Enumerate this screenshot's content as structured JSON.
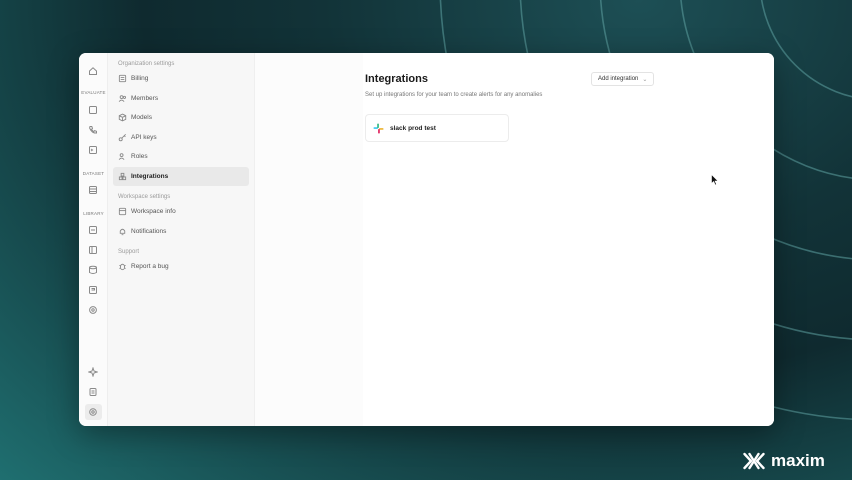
{
  "rail": {
    "evaluate_label": "EVALUATE",
    "dataset_label": "DATASET",
    "library_label": "LIBRARY"
  },
  "sidebar": {
    "sections": [
      {
        "title": "Organization settings",
        "items": [
          {
            "label": "Billing",
            "icon": "billing-icon",
            "active": false
          },
          {
            "label": "Members",
            "icon": "members-icon",
            "active": false
          },
          {
            "label": "Models",
            "icon": "models-icon",
            "active": false
          },
          {
            "label": "API keys",
            "icon": "key-icon",
            "active": false
          },
          {
            "label": "Roles",
            "icon": "roles-icon",
            "active": false
          },
          {
            "label": "Integrations",
            "icon": "integrations-icon",
            "active": true
          }
        ]
      },
      {
        "title": "Workspace settings",
        "items": [
          {
            "label": "Workspace info",
            "icon": "workspace-icon",
            "active": false
          },
          {
            "label": "Notifications",
            "icon": "bell-icon",
            "active": false
          }
        ]
      },
      {
        "title": "Support",
        "items": [
          {
            "label": "Report a bug",
            "icon": "bug-icon",
            "active": false
          }
        ]
      }
    ]
  },
  "main": {
    "title": "Integrations",
    "subtitle": "Set up integrations for your team to create alerts for any anomalies",
    "add_button": "Add integration",
    "integrations": [
      {
        "name": "slack prod test",
        "icon": "slack-icon"
      }
    ]
  },
  "brand": {
    "name": "maxim"
  },
  "colors": {
    "accent": "#1f6f70",
    "background_dark": "#0f2a2f"
  }
}
